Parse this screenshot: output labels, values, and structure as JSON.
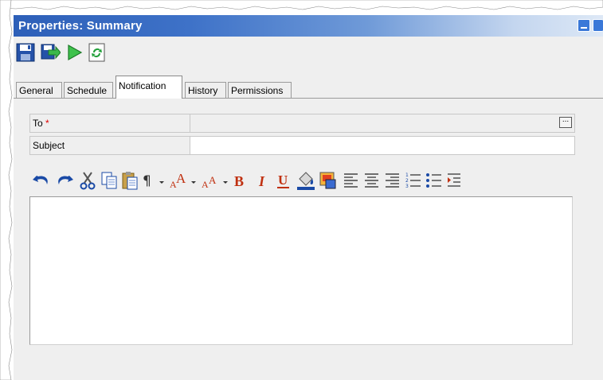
{
  "window": {
    "title": "Properties: Summary"
  },
  "tabs": [
    {
      "label": "General"
    },
    {
      "label": "Schedule"
    },
    {
      "label": "Notification",
      "active": true
    },
    {
      "label": "History"
    },
    {
      "label": "Permissions"
    }
  ],
  "form": {
    "to_label": "To",
    "required_mark": "*",
    "to_value": "",
    "browse_label": "...",
    "subject_label": "Subject",
    "subject_value": ""
  },
  "toolbar_icons": [
    "save-icon",
    "save-and-close-icon",
    "run-icon",
    "refresh-icon"
  ],
  "editor_toolbar_icons": [
    "undo-icon",
    "redo-icon",
    "cut-icon",
    "copy-icon",
    "paste-icon",
    "paragraph-icon",
    "font-size-increase-icon",
    "font-size-decrease-icon",
    "bold-icon",
    "italic-icon",
    "underline-icon",
    "text-color-icon",
    "background-color-icon",
    "align-left-icon",
    "align-center-icon",
    "align-right-icon",
    "numbered-list-icon",
    "bulleted-list-icon",
    "indent-icon"
  ],
  "editor": {
    "content": ""
  },
  "colors": {
    "titlebar_start": "#2d5fb8",
    "titlebar_end": "#dde8f6",
    "panel_bg": "#efefef",
    "required": "#e00000"
  }
}
